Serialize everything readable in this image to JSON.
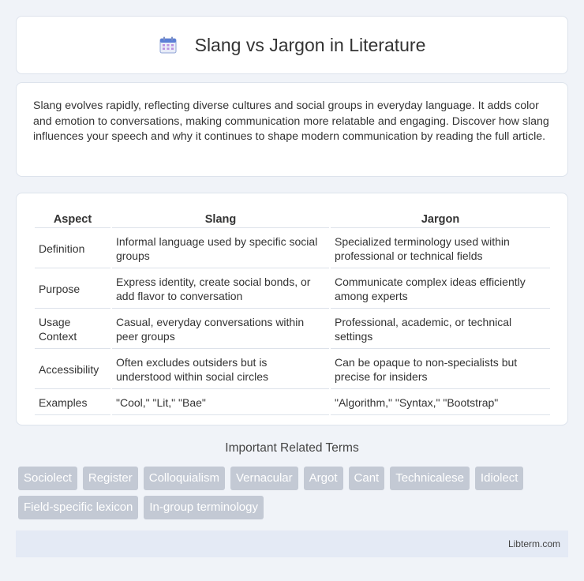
{
  "header": {
    "title": "Slang vs Jargon in Literature",
    "icon": "calendar-icon"
  },
  "intro": {
    "text": "Slang evolves rapidly, reflecting diverse cultures and social groups in everyday language. It adds color and emotion to conversations, making communication more relatable and engaging. Discover how slang influences your speech and why it continues to shape modern communication by reading the full article."
  },
  "table": {
    "headers": [
      "Aspect",
      "Slang",
      "Jargon"
    ],
    "rows": [
      [
        "Definition",
        "Informal language used by specific social groups",
        "Specialized terminology used within professional or technical fields"
      ],
      [
        "Purpose",
        "Express identity, create social bonds, or add flavor to conversation",
        "Communicate complex ideas efficiently among experts"
      ],
      [
        "Usage Context",
        "Casual, everyday conversations within peer groups",
        "Professional, academic, or technical settings"
      ],
      [
        "Accessibility",
        "Often excludes outsiders but is understood within social circles",
        "Can be opaque to non-specialists but precise for insiders"
      ],
      [
        "Examples",
        "\"Cool,\" \"Lit,\" \"Bae\"",
        "\"Algorithm,\" \"Syntax,\" \"Bootstrap\""
      ]
    ]
  },
  "related": {
    "title": "Important Related Terms",
    "tags": [
      "Sociolect",
      "Register",
      "Colloquialism",
      "Vernacular",
      "Argot",
      "Cant",
      "Technicalese",
      "Idiolect",
      "Field-specific lexicon",
      "In-group terminology"
    ]
  },
  "footer": {
    "text": "Libterm.com"
  },
  "colors": {
    "background": "#f0f3f8",
    "tag": "#c3c9d4",
    "footer": "#e4eaf5"
  }
}
